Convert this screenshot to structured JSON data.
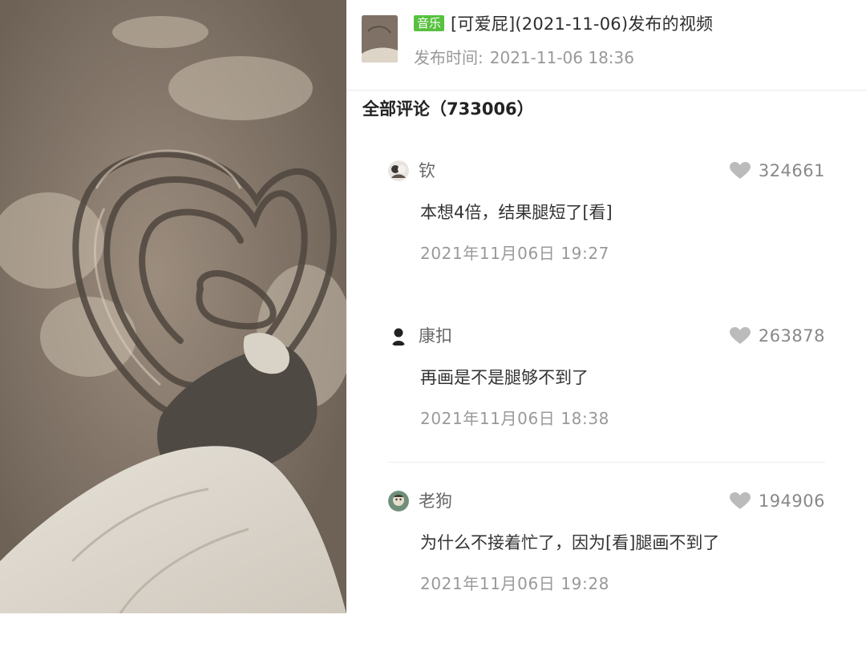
{
  "post": {
    "tag": "音乐",
    "title": "[可爱屁](2021-11-06)发布的视频",
    "time_label": "发布时间:",
    "time_value": "2021-11-06 18:36"
  },
  "comments_header": "全部评论（733006）",
  "comments": [
    {
      "user": "钦",
      "likes": "324661",
      "text": "本想4倍，结果腿短了[看]",
      "date": "2021年11月06日  19:27"
    },
    {
      "user": "康扣",
      "likes": "263878",
      "text": "再画是不是腿够不到了",
      "date": "2021年11月06日  18:38"
    },
    {
      "user": "老狗",
      "likes": "194906",
      "text": "为什么不接着忙了，因为[看]腿画不到了",
      "date": "2021年11月06日  19:28"
    }
  ],
  "icons": {
    "like": "heart-icon"
  },
  "colors": {
    "tag_bg": "#58c13f",
    "secondary_text": "#999999",
    "heart": "#bbbbbb"
  }
}
